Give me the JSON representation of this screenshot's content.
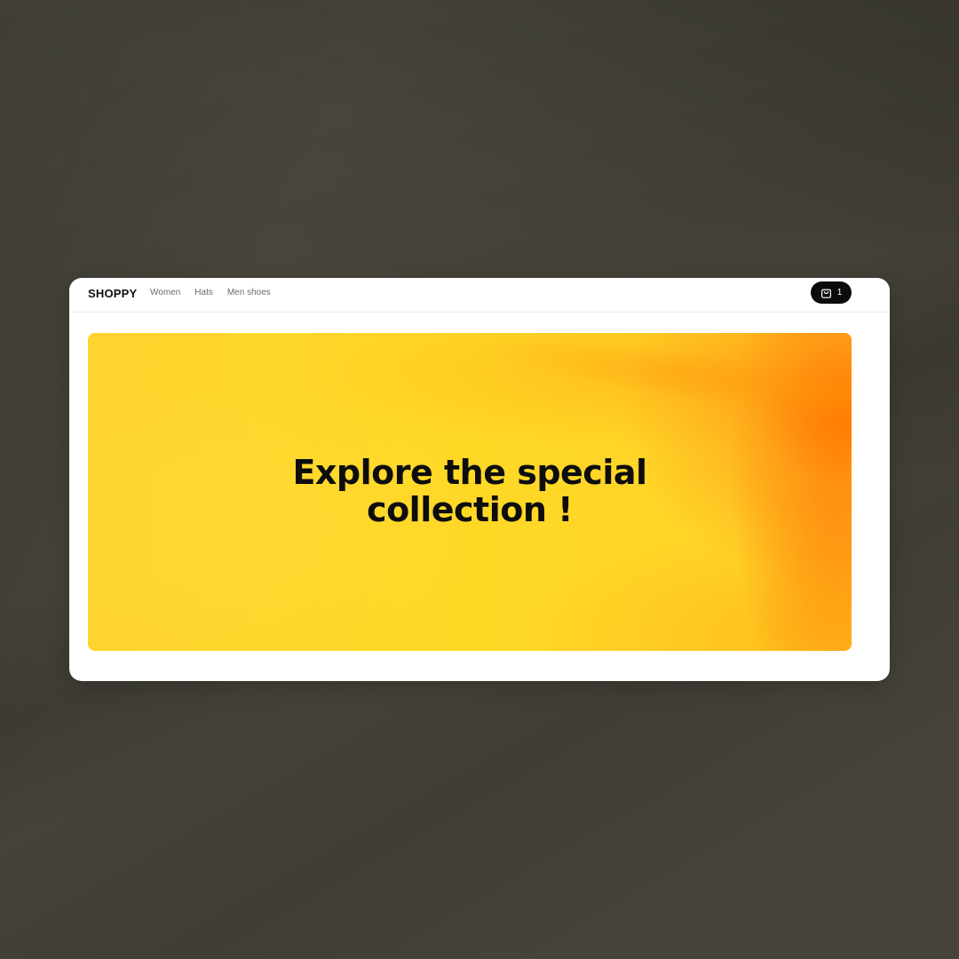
{
  "header": {
    "brand": "SHOPPY",
    "nav": [
      "Women",
      "Hats",
      "Men shoes"
    ],
    "cart": {
      "icon": "shopping-bag-icon",
      "count": "1"
    }
  },
  "hero": {
    "title_line1": "Explore the special",
    "title_line2": "collection !"
  },
  "colors": {
    "accent": "#ffd52a",
    "accent_orange": "#ff7a00",
    "cart_bg": "#0b0b0b",
    "backdrop": "#46443a"
  }
}
